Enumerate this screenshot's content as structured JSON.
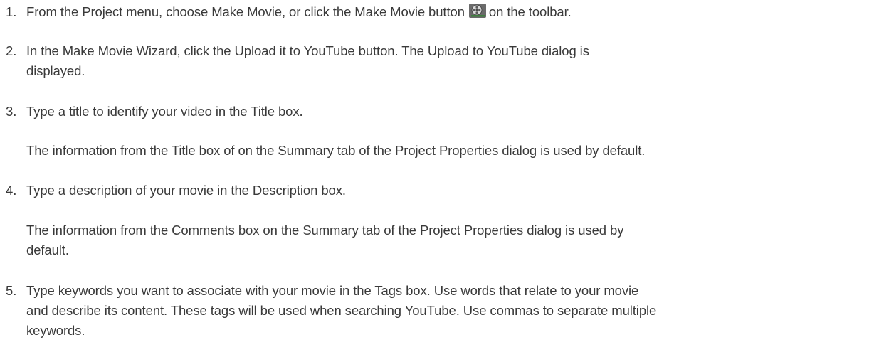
{
  "steps": [
    {
      "number": "1.",
      "text_before_icon": "From the Project menu, choose Make Movie, or click the Make Movie button",
      "icon": "film-reel-icon",
      "text_after_icon": "on the toolbar."
    },
    {
      "number": "2.",
      "line1": "In the Make Movie Wizard, click the Upload it to YouTube button. The Upload to YouTube dialog is",
      "line2": "displayed."
    },
    {
      "number": "3.",
      "text": "Type a title to identify your video in the Title box.",
      "note": "The information from the Title box of on the Summary tab of the Project Properties dialog is used by default."
    },
    {
      "number": "4.",
      "text": "Type a description of your movie in the Description box.",
      "note_line1": "The information from the Comments box on the Summary tab of the Project Properties dialog is used by",
      "note_line2": "default."
    },
    {
      "number": "5.",
      "line1": "Type keywords you want to associate with your movie in the Tags box. Use words that relate to your movie",
      "line2": "and describe its content. These tags will be used when searching YouTube. Use commas to separate multiple",
      "line3": "keywords."
    }
  ]
}
